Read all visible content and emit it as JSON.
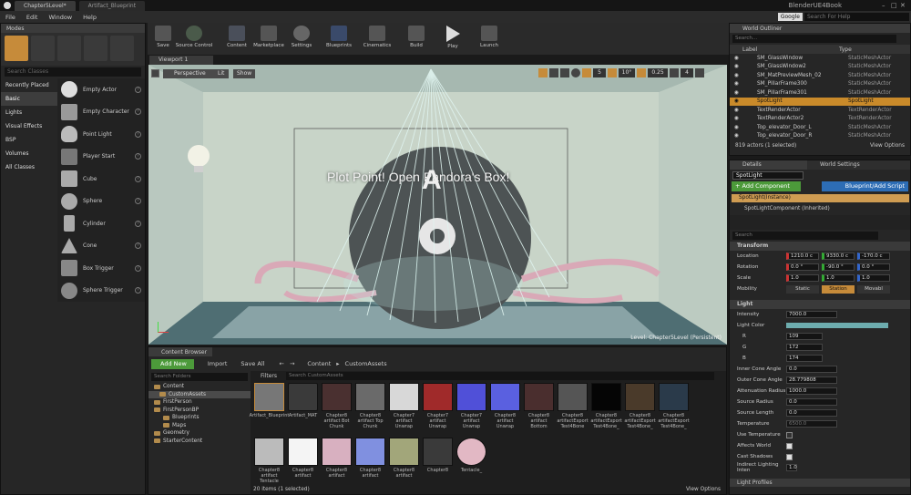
{
  "titlebar": {
    "tabs": [
      "Chapter5Level*",
      "Artifact_Blueprint"
    ],
    "project": "BlenderUE4Book"
  },
  "menu": [
    "File",
    "Edit",
    "Window",
    "Help"
  ],
  "search_help": {
    "engine": "Google",
    "placeholder": "Search For Help"
  },
  "modes": {
    "title": "Modes",
    "search_placeholder": "Search Classes",
    "categories": [
      "Recently Placed",
      "Basic",
      "Lights",
      "Visual Effects",
      "BSP",
      "Volumes",
      "All Classes"
    ],
    "items": [
      "Empty Actor",
      "Empty Character",
      "Point Light",
      "Player Start",
      "Cube",
      "Sphere",
      "Cylinder",
      "Cone",
      "Box Trigger",
      "Sphere Trigger"
    ]
  },
  "toolbar": [
    "Save",
    "Source Control",
    "Content",
    "Marketplace",
    "Settings",
    "Blueprints",
    "Cinematics",
    "Build",
    "Play",
    "Launch"
  ],
  "viewport": {
    "tab": "Viewport 1",
    "perspective": "Perspective",
    "lit": "Lit",
    "show": "Show",
    "snap_values": [
      "5",
      "10°",
      "0.25",
      "4"
    ],
    "overlay_text": "Plot Point! Open Pandora's Box!",
    "level_label": "Level:",
    "level_name": "Chapter5Level (Persistent)"
  },
  "outliner": {
    "title": "World Outliner",
    "search_placeholder": "Search...",
    "col_label": "Label",
    "col_type": "Type",
    "rows": [
      {
        "l": "SM_GlassWindow",
        "t": "StaticMeshActor"
      },
      {
        "l": "SM_GlassWindow2",
        "t": "StaticMeshActor"
      },
      {
        "l": "SM_MatPreviewMesh_02",
        "t": "StaticMeshActor"
      },
      {
        "l": "SM_PillarFrame300",
        "t": "StaticMeshActor"
      },
      {
        "l": "SM_PillarFrame301",
        "t": "StaticMeshActor"
      },
      {
        "l": "SpotLight",
        "t": "SpotLight"
      },
      {
        "l": "TextRenderActor",
        "t": "TextRenderActor"
      },
      {
        "l": "TextRenderActor2",
        "t": "TextRenderActor"
      },
      {
        "l": "Top_elevator_Door_L",
        "t": "StaticMeshActor"
      },
      {
        "l": "Top_elevator_Door_R",
        "t": "StaticMeshActor"
      }
    ],
    "count": "819 actors (1 selected)",
    "view_options": "View Options"
  },
  "details": {
    "tab1": "Details",
    "tab2": "World Settings",
    "name": "SpotLight",
    "add_component": "+ Add Component",
    "blueprint": "Blueprint/Add Script",
    "instance": "SpotLight(Instance)",
    "component": "SpotLightComponent (Inherited)",
    "search_placeholder": "Search",
    "transform": "Transform",
    "location": "Location",
    "rotation": "Rotation",
    "scale": "Scale",
    "mobility": "Mobility",
    "loc": [
      "1210.0 c",
      "9330.0 c",
      "-170.0 c"
    ],
    "rot": [
      "0.0 °",
      "-90.0 °",
      "0.0 °"
    ],
    "scl": [
      "1.0",
      "1.0",
      "1.0"
    ],
    "mob": [
      "Static",
      "Station",
      "Movabl"
    ],
    "light": "Light",
    "props": [
      {
        "n": "Intensity",
        "v": "7000.0"
      },
      {
        "n": "Light Color",
        "v": ""
      },
      {
        "n": "R",
        "v": "109"
      },
      {
        "n": "G",
        "v": "172"
      },
      {
        "n": "B",
        "v": "174"
      },
      {
        "n": "Inner Cone Angle",
        "v": "0.0"
      },
      {
        "n": "Outer Cone Angle",
        "v": "28.779808"
      },
      {
        "n": "Attenuation Radius",
        "v": "1000.0"
      },
      {
        "n": "Source Radius",
        "v": "0.0"
      },
      {
        "n": "Source Length",
        "v": "0.0"
      },
      {
        "n": "Temperature",
        "v": "6500.0"
      }
    ],
    "checks": [
      "Use Temperature",
      "Affects World",
      "Cast Shadows"
    ],
    "indirect": "Indirect Lighting Inten",
    "indirect_v": "1.0",
    "light_profiles": "Light Profiles"
  },
  "content": {
    "title": "Content Browser",
    "add_new": "Add New",
    "import": "Import",
    "save_all": "Save All",
    "path_root": "Content",
    "path_child": "CustomAssets",
    "folders_search": "Search Folders",
    "filters": "Filters",
    "assets_search": "Search CustomAssets",
    "folders": [
      "Content",
      "CustomAssets",
      "FirstPerson",
      "FirstPersonBP",
      "Blueprints",
      "Maps",
      "Geometry",
      "StarterContent"
    ],
    "assets": [
      "Artifact_Blueprint",
      "Artifact_MAT",
      "Chapter8 artifact Bot Chunk",
      "Chapter8 artifact Top Chunk",
      "Chapter7 artifact Unwrap",
      "Chapter7 artifact Unwrap",
      "Chapter7 artifact Unwrap",
      "Chapter8 artifact Unwrap",
      "Chapter8 artifact Bottom",
      "Chapter8 artifactExport Test4Bone",
      "Chapter8 artifactExport Test4Bone_",
      "Chapter8 artifactExport Test4Bone_",
      "Chapter8 artifactExport Test4Bone_",
      "Chapter8 artifact Tentacle",
      "Chapter8 artifact",
      "Chapter8 artifact",
      "Chapter8 artifact",
      "Chapter8 artifact",
      "Chapter8",
      "Tentacle_"
    ],
    "count": "20 items (1 selected)",
    "view_options": "View Options"
  }
}
